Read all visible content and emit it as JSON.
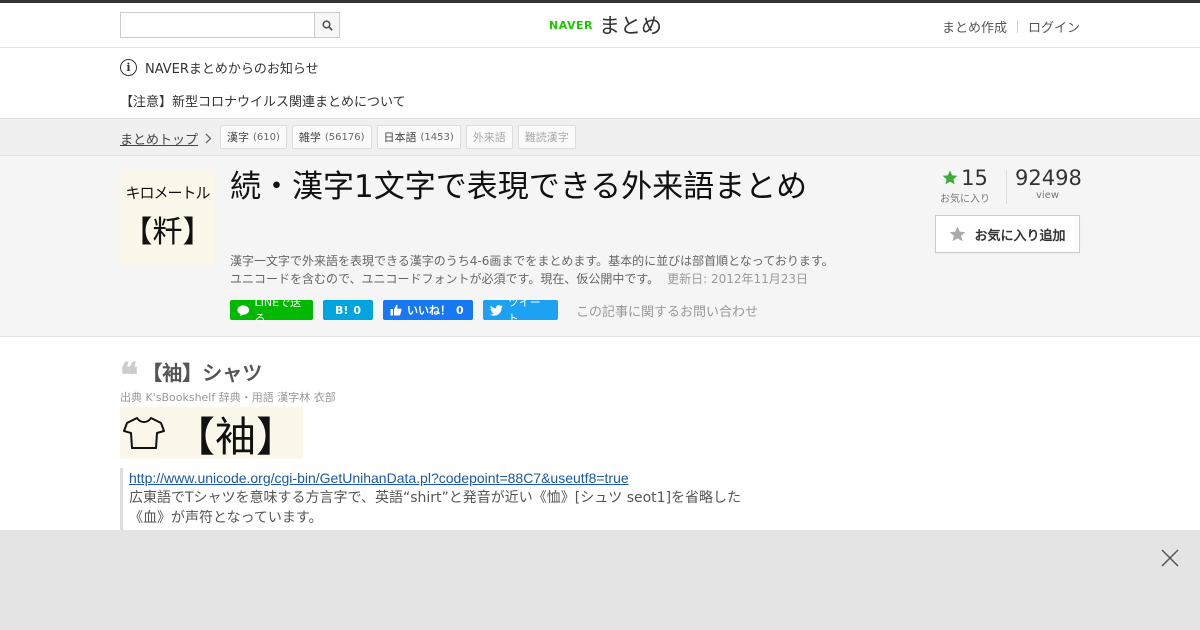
{
  "header": {
    "search_placeholder": "",
    "logo_naver": "NAVER",
    "logo_matome": "まとめ",
    "links": [
      "まとめ作成",
      "ログイン"
    ],
    "brand_color": "#1ec800"
  },
  "notice": {
    "title": "NAVERまとめからのお知らせ",
    "link": "【注意】新型コロナウイルス関連まとめについて"
  },
  "breadcrumb": {
    "top": "まとめトップ",
    "tags": [
      {
        "label": "漢字",
        "count": "(610)"
      },
      {
        "label": "雑学",
        "count": "(56176)"
      },
      {
        "label": "日本語",
        "count": "(1453)"
      },
      {
        "label": "外来語",
        "count": ""
      },
      {
        "label": "難読漢字",
        "count": ""
      }
    ]
  },
  "article": {
    "thumbnail_line1": "キロメートル",
    "thumbnail_line2": "【粁】",
    "title": "続・漢字1文字で表現できる外来語まとめ",
    "description_line1": "漢字一文字で外来語を表現できる漢字のうち4-6画までをまとめます。基本的に並びは部首順となっております。",
    "description_line2": "ユニコードを含むので、ユニコードフォントが必須です。現在、仮公開中です。",
    "updated": "更新日: 2012年11月23日",
    "share": {
      "line": "LINEで送る",
      "hatena_count": "0",
      "fb_label": "いいね！",
      "fb_count": "0",
      "tweet": "ツイート"
    },
    "contact": "この記事に関するお問い合わせ",
    "favorites": "15",
    "favorites_label": "お気に入り",
    "views": "92498",
    "views_label": "view",
    "fav_button": "お気に入り追加"
  },
  "item": {
    "heading": "【袖】シャツ",
    "source": "出典  K'sBookshelf 辞典・用語 漢字林 衣部",
    "image_text": "【袖】",
    "link": "http://www.unicode.org/cgi-bin/GetUnihanData.pl?codepoint=88C7&useutf8=true",
    "text_line1": "広東語でTシャツを意味する方言字で、英語“shirt”と発音が近い《恤》[シュツ seot1]を省略した",
    "text_line2": "《血》が声符となっています。"
  }
}
